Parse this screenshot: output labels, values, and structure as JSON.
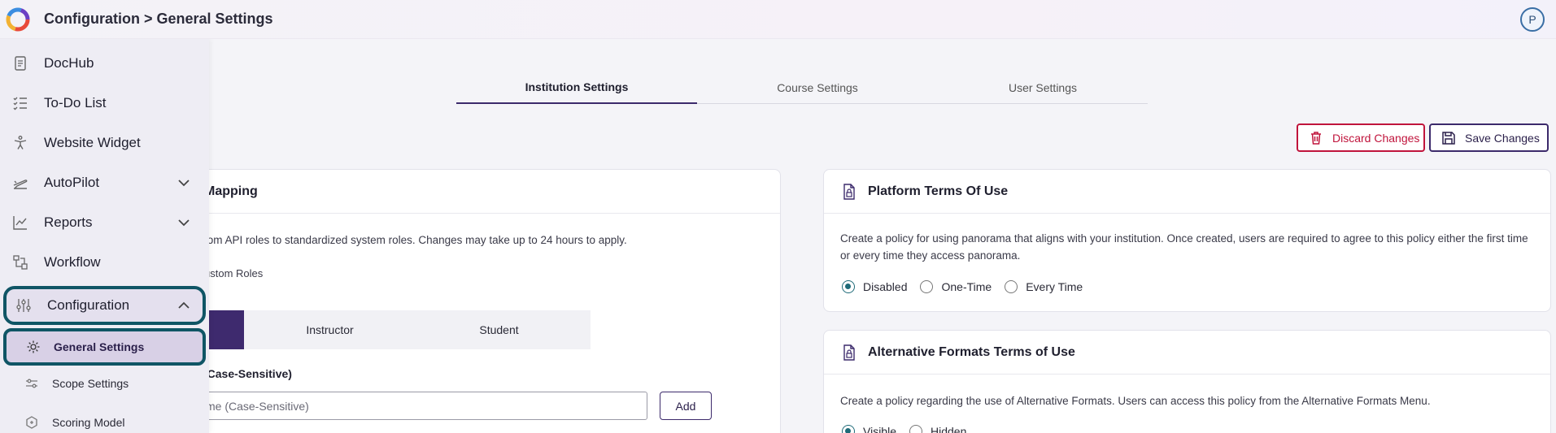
{
  "topbar": {
    "breadcrumb": "Configuration > General Settings",
    "avatar_initial": "P"
  },
  "sidebar": {
    "items": [
      {
        "label": "DocHub",
        "icon": "document-icon"
      },
      {
        "label": "To-Do List",
        "icon": "checklist-icon"
      },
      {
        "label": "Website Widget",
        "icon": "accessibility-icon"
      },
      {
        "label": "AutoPilot",
        "icon": "plane-icon"
      },
      {
        "label": "Reports",
        "icon": "line-chart-icon"
      },
      {
        "label": "Workflow",
        "icon": "workflow-icon"
      },
      {
        "label": "Configuration",
        "icon": "sliders-icon"
      }
    ],
    "subitems": [
      {
        "label": "General Settings",
        "icon": "gear-icon"
      },
      {
        "label": "Scope Settings",
        "icon": "sliders-small-icon"
      },
      {
        "label": "Scoring Model",
        "icon": "scoring-icon"
      }
    ]
  },
  "tabs": [
    "Institution Settings",
    "Course Settings",
    "User Settings"
  ],
  "actions": {
    "discard": "Discard Changes",
    "save": "Save Changes"
  },
  "left_card": {
    "title": "Mapping",
    "description": "tom API roles to standardized system roles. Changes may take up to 24 hours to apply.",
    "custom_roles_label": "ustom Roles",
    "role_tabs": [
      "",
      "Instructor",
      "Student"
    ],
    "field_label": "(Case-Sensitive)",
    "input_placeholder": "me (Case-Sensitive)",
    "add_label": "Add"
  },
  "platform_terms": {
    "title": "Platform Terms Of Use",
    "description": "Create a policy for using panorama that aligns with your institution. Once created, users are required to agree to this policy either the first time or every time they access panorama.",
    "options": [
      "Disabled",
      "One-Time",
      "Every Time"
    ],
    "selected": "Disabled"
  },
  "alt_formats_terms": {
    "title": "Alternative Formats Terms of Use",
    "description": "Create a policy regarding the use of Alternative Formats. Users can access this policy from the Alternative Formats Menu.",
    "options": [
      "Visible",
      "Hidden"
    ],
    "selected": "Visible"
  }
}
